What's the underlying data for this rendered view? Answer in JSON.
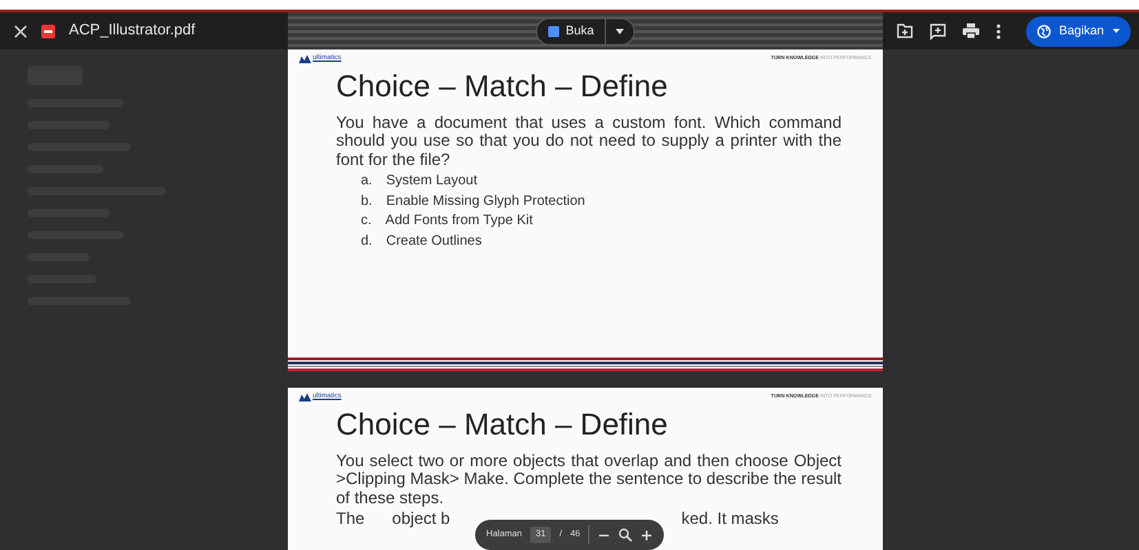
{
  "header": {
    "file_name": "ACP_Illustrator.pdf",
    "open_button": "Buka",
    "share_button": "Bagikan"
  },
  "pages": [
    {
      "brand": "ultimatics",
      "tagline": "**TURN KNOWLEDGE** INTO PERFORMANCE",
      "title": "Choice – Match – Define",
      "question": "You have a document that uses a custom font. Which command should you use so that you do not need to supply a printer with the font for the file?",
      "options": [
        {
          "letter": "a.",
          "text": "System Layout"
        },
        {
          "letter": "b.",
          "text": "Enable Missing Glyph Protection"
        },
        {
          "letter": "c.",
          "text": "Add Fonts from Type Kit"
        },
        {
          "letter": "d.",
          "text": "Create Outlines"
        }
      ]
    },
    {
      "brand": "ultimatics",
      "tagline": "**TURN KNOWLEDGE** INTO PERFORMANCE",
      "title": "Choice – Match – Define",
      "question": "You select two or more objects that overlap and then choose Object >Clipping Mask> Make. Complete the sentence to describe the result of these steps.",
      "answer_line": {
        "before": "The      object b",
        "after": "ked. It masks"
      }
    }
  ],
  "page_toolbar": {
    "label": "Halaman",
    "current": "31",
    "separator": "/",
    "total": "46"
  }
}
